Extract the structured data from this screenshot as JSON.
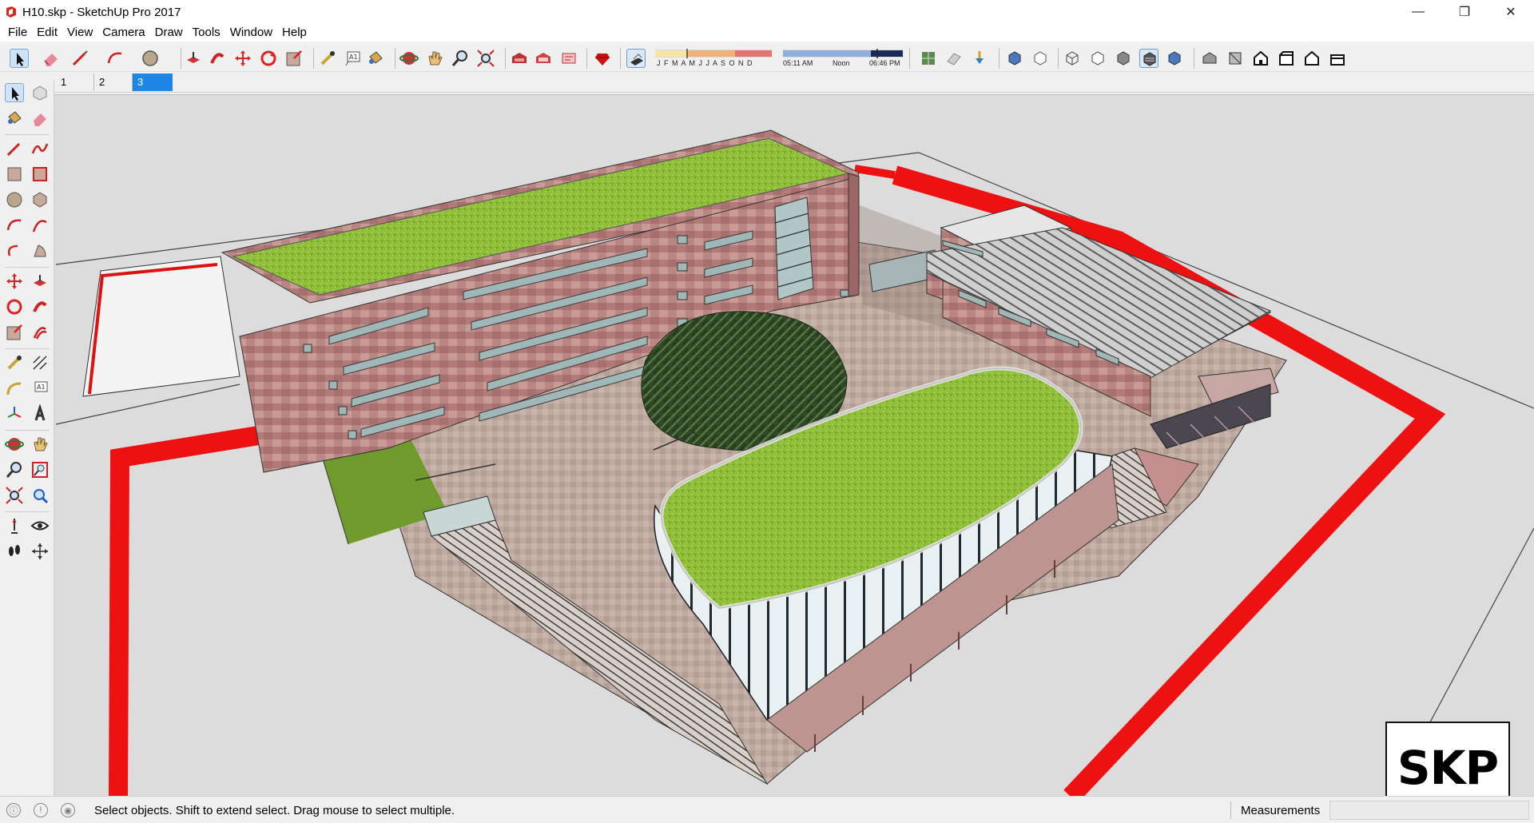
{
  "window": {
    "title": "H10.skp - SketchUp Pro 2017",
    "controls": {
      "minimize": "—",
      "maximize": "❐",
      "close": "✕"
    }
  },
  "menu": [
    "File",
    "Edit",
    "View",
    "Camera",
    "Draw",
    "Tools",
    "Window",
    "Help"
  ],
  "shadow_settings": {
    "months": "J F M A M J J A S O N D",
    "time_start": "05:11 AM",
    "time_mid": "Noon",
    "time_end": "06:46 PM"
  },
  "scenes": [
    {
      "label": "1",
      "active": false
    },
    {
      "label": "2",
      "active": false
    },
    {
      "label": "3",
      "active": true
    }
  ],
  "status": {
    "hint": "Select objects. Shift to extend select. Drag mouse to select multiple.",
    "measurements_label": "Measurements",
    "measurements_value": ""
  },
  "badge": {
    "text": "SKP"
  },
  "colors": {
    "accent": "#1e87e5",
    "ground": "#dcdcdc",
    "boundary_red": "#ee1111",
    "roof_green": "#8fbf3a",
    "facade": "#b88a88"
  },
  "icons": {
    "toolbar": [
      "select-icon",
      "eraser-icon",
      "pencil-line-icon",
      "arc-icon",
      "circle-icon",
      "push-pull-icon",
      "follow-me-icon",
      "move-icon",
      "rotate-icon",
      "scale-icon",
      "tape-measure-icon",
      "text-icon",
      "paint-bucket-icon",
      "orbit-icon",
      "pan-icon",
      "zoom-icon",
      "zoom-extents-icon",
      "warehouse-icon",
      "extension-warehouse-icon",
      "layout-icon",
      "ruby-icon",
      "shadows-toggle-icon",
      "geo-location-icon",
      "add-location-icon",
      "photo-textures-icon",
      "x-ray-icon",
      "back-edges-icon",
      "wireframe-icon",
      "hidden-line-icon",
      "shaded-icon",
      "shaded-textures-icon",
      "monochrome-icon",
      "iso-view-icon",
      "top-view-icon",
      "front-view-icon",
      "right-view-icon",
      "back-view-icon",
      "left-view-icon"
    ]
  }
}
